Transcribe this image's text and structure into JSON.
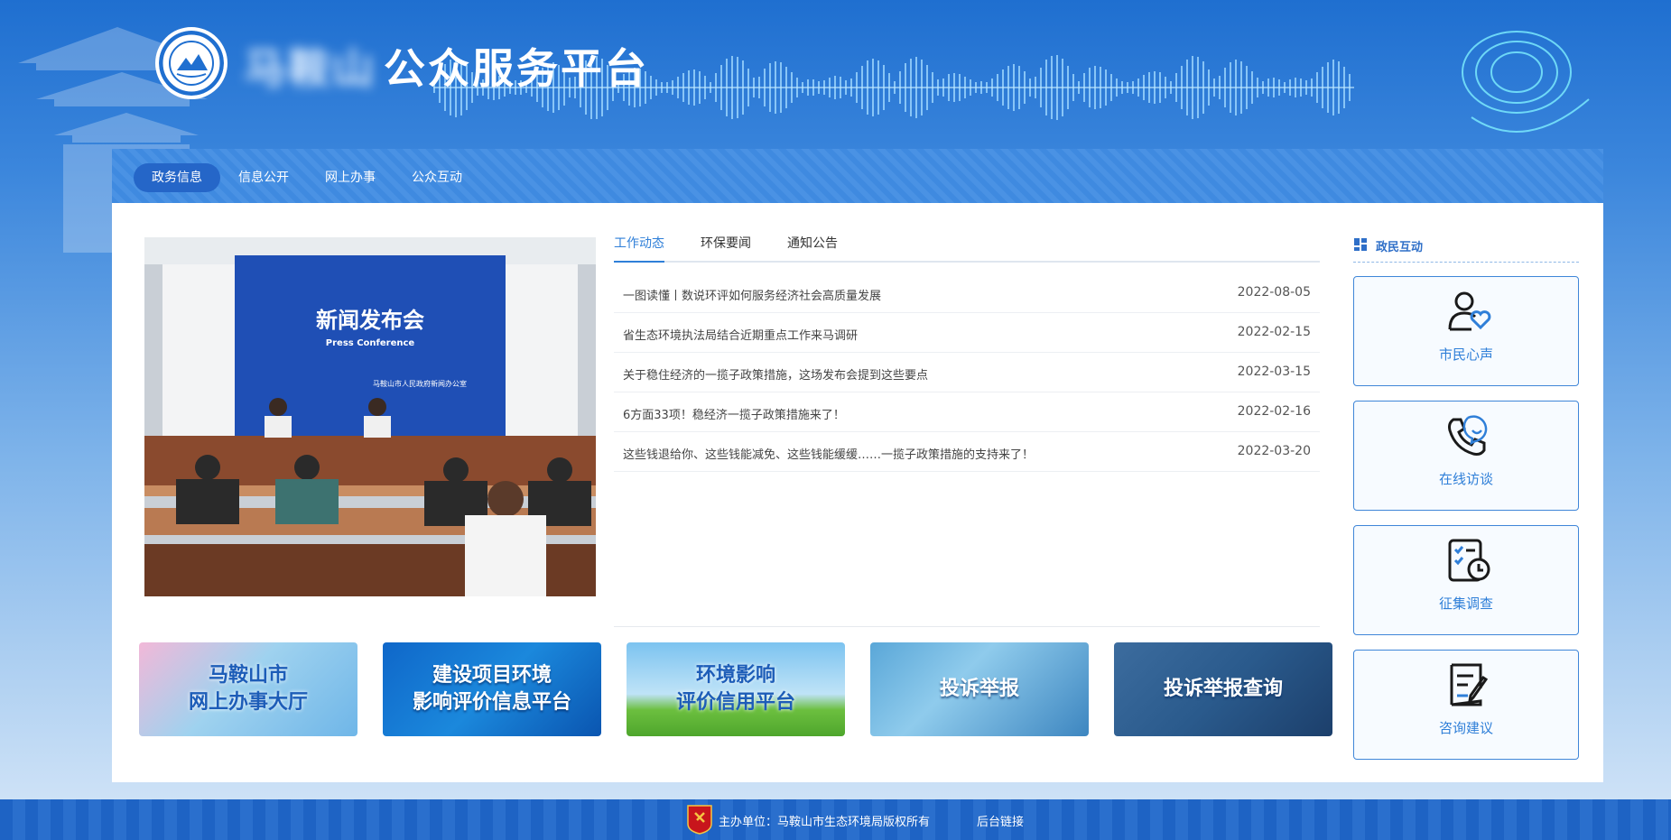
{
  "header": {
    "title_blurred": "马鞍山",
    "title": "公众服务平台",
    "logo_icon": "emblem-icon"
  },
  "nav": {
    "items": [
      {
        "label": "政务信息",
        "active": true
      },
      {
        "label": "信息公开",
        "active": false
      },
      {
        "label": "网上办事",
        "active": false
      },
      {
        "label": "公众互动",
        "active": false
      }
    ]
  },
  "photo": {
    "banner_text": "新闻发布会",
    "banner_sub": "Press Conference",
    "banner_org": "马鞍山市人民政府新闻办公室"
  },
  "news": {
    "tabs": [
      {
        "label": "工作动态",
        "active": true
      },
      {
        "label": "环保要闻",
        "active": false
      },
      {
        "label": "通知公告",
        "active": false
      }
    ],
    "items": [
      {
        "title": "一图读懂丨数说环评如何服务经济社会高质量发展",
        "date": "2022-08-05"
      },
      {
        "title": "省生态环境执法局结合近期重点工作来马调研",
        "date": "2022-02-15"
      },
      {
        "title": "关于稳住经济的一揽子政策措施，这场发布会提到这些要点",
        "date": "2022-03-15"
      },
      {
        "title": "6方面33项！稳经济一揽子政策措施来了！",
        "date": "2022-02-16"
      },
      {
        "title": "这些钱退给你、这些钱能减免、这些钱能缓缓……一揽子政策措施的支持来了！",
        "date": "2022-03-20"
      }
    ]
  },
  "banners": [
    {
      "line1": "马鞍山市",
      "line2": "网上办事大厅"
    },
    {
      "line1": "建设项目环境",
      "line2": "影响评价信息平台"
    },
    {
      "line1": "环境影响",
      "line2": "评价信用平台"
    },
    {
      "line1": "投诉举报",
      "line2": ""
    },
    {
      "line1": "投诉举报查询",
      "line2": ""
    }
  ],
  "side": {
    "title": "政民互动",
    "cards": [
      {
        "label": "市民心声",
        "icon": "person-heart-icon"
      },
      {
        "label": "在线访谈",
        "icon": "phone-chat-icon"
      },
      {
        "label": "征集调查",
        "icon": "checklist-clock-icon"
      },
      {
        "label": "咨询建议",
        "icon": "note-pen-icon"
      }
    ]
  },
  "footer": {
    "host_text": "主办单位：马鞍山市生态环境局版权所有",
    "admin_link": "后台链接",
    "badge_icon": "party-badge-icon"
  },
  "colors": {
    "primary": "#2f7fd8",
    "nav_active": "#2566c8",
    "footer": "#1e63c4"
  }
}
